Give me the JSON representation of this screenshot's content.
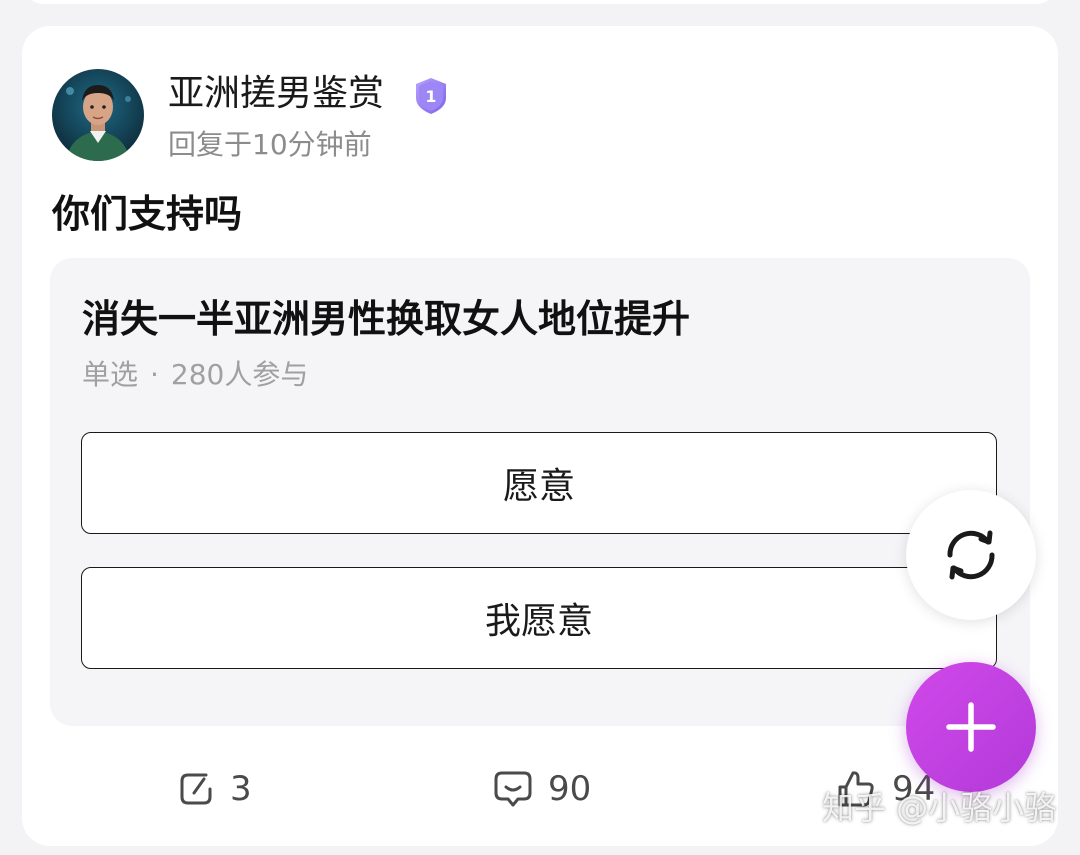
{
  "author": {
    "name": "亚洲搓男鉴赏",
    "badge_text": "1",
    "avatar_icon": "avatar-photo",
    "reply_time": "回复于10分钟前"
  },
  "post": {
    "text": "你们支持吗"
  },
  "poll": {
    "title": "消失一半亚洲男性换取女人地位提升",
    "type": "单选",
    "separator": "·",
    "participants": "280人参与",
    "options": [
      {
        "label": "愿意"
      },
      {
        "label": "我愿意"
      }
    ]
  },
  "actions": {
    "repost_count": "3",
    "comment_count": "90",
    "like_count": "94"
  },
  "watermark": "知乎 @小骆小骆",
  "colors": {
    "background": "#f3f3f5",
    "card": "#ffffff",
    "poll_bg": "#f5f5f8",
    "fab_accent": "#c43fe0",
    "badge_purple": "#9b7cf0",
    "muted_text": "#8c8c8c"
  }
}
